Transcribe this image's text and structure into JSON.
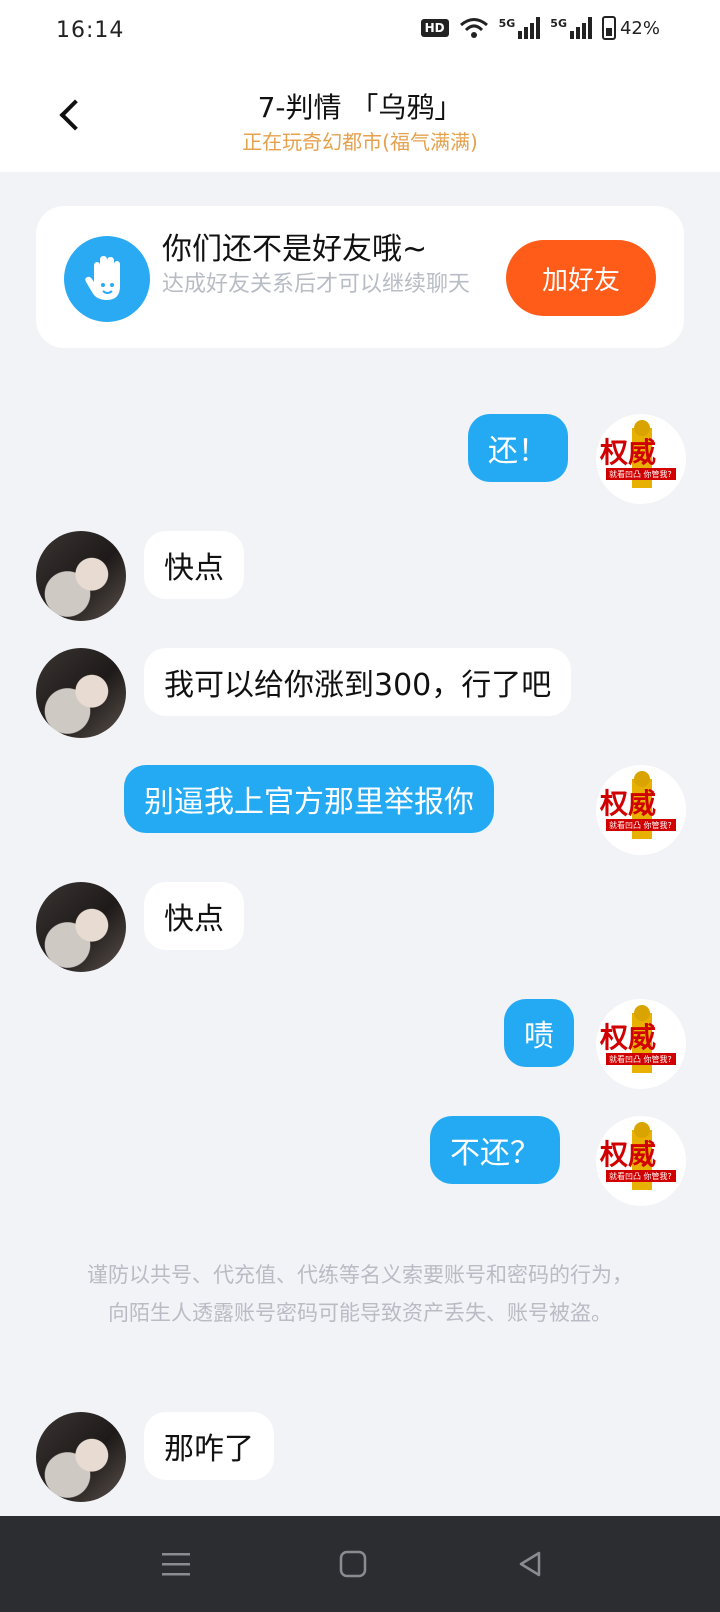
{
  "status_bar": {
    "time": "16:14",
    "hd": "HD",
    "network1": "5G",
    "network2": "5G",
    "battery": "42%"
  },
  "header": {
    "title": "7-判情 「乌鸦」",
    "subtitle": "正在玩奇幻都市(福气满满)"
  },
  "banner": {
    "title": "你们还不是好友哦~",
    "desc": "达成好友关系后才可以继续聊天",
    "add_button": "加好友"
  },
  "messages": [
    {
      "side": "out",
      "text": "还！"
    },
    {
      "side": "in",
      "text": "快点"
    },
    {
      "side": "in",
      "text": "我可以给你涨到300，行了吧"
    },
    {
      "side": "out",
      "text": "别逼我上官方那里举报你"
    },
    {
      "side": "in",
      "text": "快点"
    },
    {
      "side": "out",
      "text": "啧"
    },
    {
      "side": "out",
      "text": "不还？"
    },
    {
      "side": "in",
      "text": "那咋了"
    }
  ],
  "avatar_me_text": {
    "big": "权威",
    "small": "就看凹凸 你管我?"
  },
  "notice": "谨防以共号、代充值、代练等名义索要账号和密码的行为，向陌生人透露账号密码可能导致资产丢失、账号被盗。",
  "nav": {
    "icons": [
      "menu-icon",
      "home-icon",
      "back-triangle-icon"
    ]
  },
  "colors": {
    "accent": "#24aaf3",
    "add_button": "#ff5c1a",
    "subtitle": "#e5a24e"
  }
}
